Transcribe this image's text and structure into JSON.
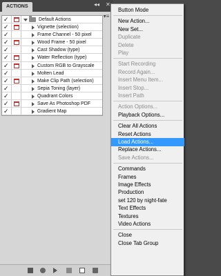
{
  "panel": {
    "tab_label": "ACTIONS",
    "collapse_glyph": "◂◂",
    "close_glyph": "✕",
    "menu_glyph": "▾≡",
    "check_glyph": "✓",
    "set_name": "Default Actions",
    "actions": [
      {
        "label": "Vignette (selection)",
        "dialog": true
      },
      {
        "label": "Frame Channel - 50 pixel",
        "dialog": false
      },
      {
        "label": "Wood Frame - 50 pixel",
        "dialog": true
      },
      {
        "label": "Cast Shadow (type)",
        "dialog": false
      },
      {
        "label": "Water Reflection (type)",
        "dialog": true
      },
      {
        "label": "Custom RGB to Grayscale",
        "dialog": true
      },
      {
        "label": "Molten Lead",
        "dialog": false
      },
      {
        "label": "Make Clip Path (selection)",
        "dialog": true
      },
      {
        "label": "Sepia Toning (layer)",
        "dialog": false
      },
      {
        "label": "Quadrant Colors",
        "dialog": false
      },
      {
        "label": "Save As Photoshop PDF",
        "dialog": true
      },
      {
        "label": "Gradient Map",
        "dialog": false
      }
    ],
    "bottom_icons": [
      "stop-icon",
      "record-icon",
      "play-icon",
      "new-set-icon",
      "new-action-icon",
      "delete-icon"
    ]
  },
  "menu": {
    "items": [
      {
        "label": "Button Mode",
        "enabled": true
      },
      {
        "sep": true
      },
      {
        "label": "New Action...",
        "enabled": true
      },
      {
        "label": "New Set...",
        "enabled": true
      },
      {
        "label": "Duplicate",
        "enabled": false
      },
      {
        "label": "Delete",
        "enabled": false
      },
      {
        "label": "Play",
        "enabled": false
      },
      {
        "sep": true
      },
      {
        "label": "Start Recording",
        "enabled": false
      },
      {
        "label": "Record Again...",
        "enabled": false
      },
      {
        "label": "Insert Menu Item...",
        "enabled": false
      },
      {
        "label": "Insert Stop...",
        "enabled": false
      },
      {
        "label": "Insert Path",
        "enabled": false
      },
      {
        "sep": true
      },
      {
        "label": "Action Options...",
        "enabled": false
      },
      {
        "label": "Playback Options...",
        "enabled": true
      },
      {
        "sep": true
      },
      {
        "label": "Clear All Actions",
        "enabled": true
      },
      {
        "label": "Reset Actions",
        "enabled": true
      },
      {
        "label": "Load Actions...",
        "enabled": true,
        "highlighted": true
      },
      {
        "label": "Replace Actions...",
        "enabled": true
      },
      {
        "label": "Save Actions...",
        "enabled": false
      },
      {
        "sep": true
      },
      {
        "label": "Commands",
        "enabled": true
      },
      {
        "label": "Frames",
        "enabled": true
      },
      {
        "label": "Image Effects",
        "enabled": true
      },
      {
        "label": "Production",
        "enabled": true
      },
      {
        "label": "set 120 by night-fate",
        "enabled": true
      },
      {
        "label": "Text Effects",
        "enabled": true
      },
      {
        "label": "Textures",
        "enabled": true
      },
      {
        "label": "Video Actions",
        "enabled": true
      },
      {
        "sep": true
      },
      {
        "label": "Close",
        "enabled": true
      },
      {
        "label": "Close Tab Group",
        "enabled": true
      }
    ]
  },
  "colors": {
    "highlight": "#3399ff",
    "dialog_toggle": "#c03030",
    "disabled_text": "#8a8a8a"
  }
}
